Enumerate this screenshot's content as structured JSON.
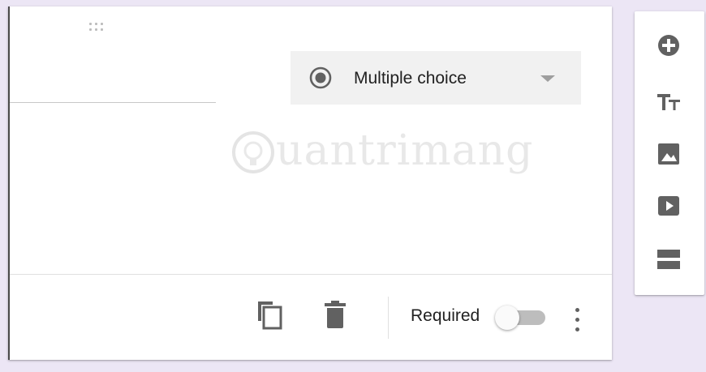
{
  "question": {
    "type_select": {
      "selected_label": "Multiple choice",
      "icon": "radio-checked-icon"
    },
    "watermark": "uantrimang"
  },
  "footer": {
    "copy_icon": "copy-icon",
    "delete_icon": "trash-icon",
    "required_label": "Required",
    "required_on": false,
    "more_icon": "more-vert-icon"
  },
  "toolbar": {
    "items": [
      {
        "name": "add-question",
        "icon": "add-circle-icon"
      },
      {
        "name": "add-title",
        "icon": "title-icon"
      },
      {
        "name": "add-image",
        "icon": "image-icon"
      },
      {
        "name": "add-video",
        "icon": "video-icon"
      },
      {
        "name": "add-section",
        "icon": "section-icon"
      }
    ]
  },
  "colors": {
    "background": "#ece6f5",
    "card": "#ffffff",
    "select_bg": "#f1f1f1",
    "icon": "#616161",
    "toggle_track": "#bdbdbd"
  }
}
